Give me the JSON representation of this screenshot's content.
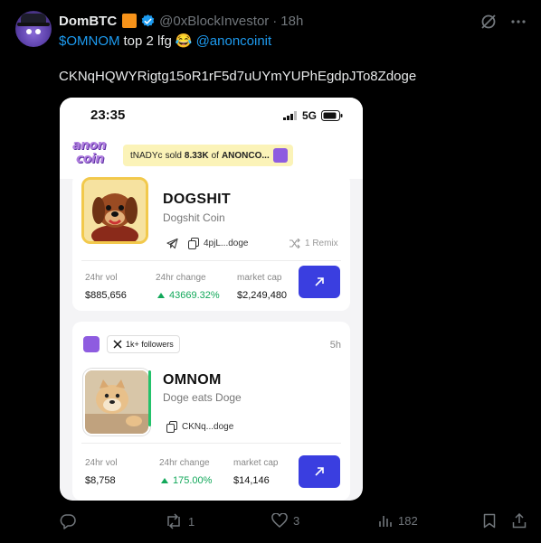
{
  "tweet": {
    "display_name": "DomBTC",
    "handle": "@0xBlockInvestor",
    "time_ago": "18h",
    "text_ticker": "$OMNOM",
    "text_mid": "top 2 lfg",
    "emoji": "😂",
    "mention": "@anoncoinit",
    "address": "CKNqHQWYRigtg15oR1rF5d7uUYmYUPhEgdpJTo8Zdoge"
  },
  "colors": {
    "link": "#1d9bf0",
    "accent_button": "#3a3ee0",
    "positive": "#12a85a",
    "orange_badge": "#f7931a"
  },
  "screenshot": {
    "status_time": "23:35",
    "network": "5G",
    "logo_line1": "anon",
    "logo_line2": "coin",
    "ticker_user": "tNADYc",
    "ticker_sold": "sold",
    "ticker_amount": "8.33K",
    "ticker_of": "of",
    "ticker_token": "ANONCO...",
    "card1": {
      "name": "DOGSHIT",
      "subtitle": "Dogshit Coin",
      "contract": "4pjL...doge",
      "remix": "1 Remix",
      "vol_label": "24hr vol",
      "vol": "$885,656",
      "change_label": "24hr change",
      "change": "43669.32%",
      "cap_label": "market cap",
      "cap": "$2,249,480"
    },
    "card2": {
      "followers": "1k+ followers",
      "age": "5h",
      "name": "OMNOM",
      "subtitle": "Doge eats Doge",
      "contract": "CKNq...doge",
      "vol_label": "24hr vol",
      "vol": "$8,758",
      "change_label": "24hr change",
      "change": "175.00%",
      "cap_label": "market cap",
      "cap": "$14,146"
    }
  },
  "actions": {
    "reposts": "1",
    "likes": "3",
    "views": "182"
  }
}
